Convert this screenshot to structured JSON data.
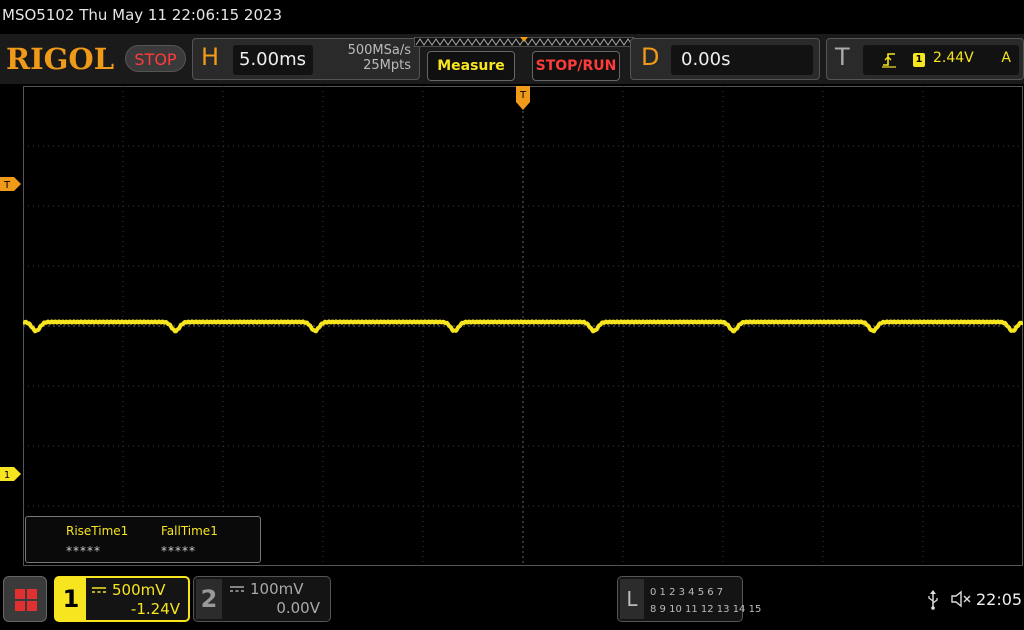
{
  "title_bar": {
    "text": "MSO5102  Thu May 11 22:06:15 2023"
  },
  "top_bar": {
    "brand": "RIGOL",
    "run_state": "STOP",
    "horizontal": {
      "letter": "H",
      "timebase": "5.00ms",
      "sample_rate": "500MSa/s",
      "memory_depth": "25Mpts"
    },
    "measure_label": "Measure",
    "stop_run_label": "STOP/RUN",
    "delay": {
      "letter": "D",
      "value": "0.00s"
    },
    "trigger": {
      "letter": "T",
      "source": "1",
      "level": "2.44V",
      "mode": "A",
      "edge_icon": "rising-edge-icon"
    }
  },
  "markers": {
    "trigger_level_label": "T",
    "ch1_ground_label": "1",
    "trigger_position_label": "T"
  },
  "measurements": [
    {
      "label": "RiseTime1",
      "value": "*****"
    },
    {
      "label": "FallTime1",
      "value": "*****"
    }
  ],
  "bottom_bar": {
    "ch1": {
      "number": "1",
      "scale": "500mV",
      "offset": "-1.24V",
      "coupling_icon": "dc-coupling-icon"
    },
    "ch2": {
      "number": "2",
      "scale": "100mV",
      "offset": "0.00V",
      "coupling_icon": "dc-coupling-icon"
    },
    "logic": {
      "letter": "L",
      "row1": "0 1 2 3  4 5 6 7",
      "row2": "8 9 10 11 12 13 14 15"
    },
    "clock": "22:05"
  },
  "colors": {
    "ch1": "#f6e51f",
    "accent": "#f09a1a",
    "stop": "#ff3b3b",
    "grid": "#444444"
  }
}
